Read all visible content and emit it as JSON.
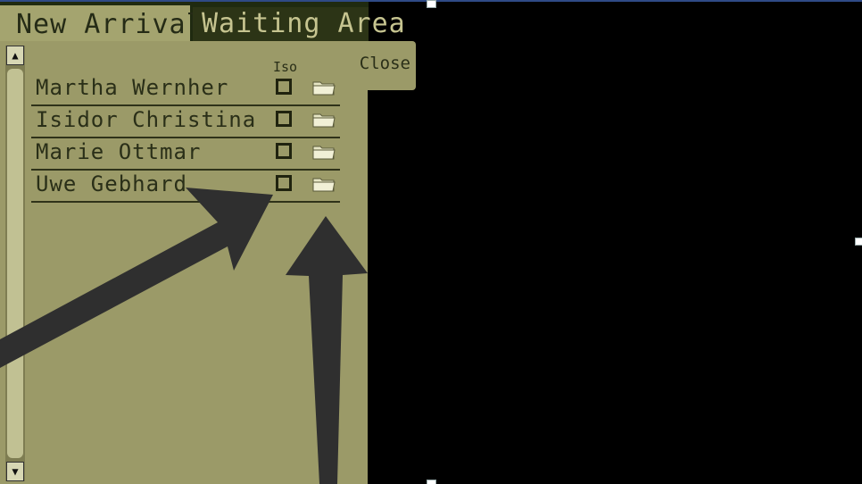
{
  "tabs": [
    {
      "label": "New Arrivals"
    },
    {
      "label": "Waiting Area"
    }
  ],
  "close_label": "Close",
  "columns": {
    "iso": "Iso"
  },
  "patients": [
    {
      "name": "Martha Wernher",
      "iso": false
    },
    {
      "name": "Isidor Christina",
      "iso": false
    },
    {
      "name": "Marie Ottmar",
      "iso": false
    },
    {
      "name": "Uwe Gebhard",
      "iso": false
    }
  ],
  "scrollbar": {
    "up_glyph": "▲",
    "down_glyph": "▼"
  },
  "icons": {
    "folder": "folder-icon",
    "checkbox": "checkbox-icon",
    "arrow": "arrow-annotation"
  },
  "colors": {
    "panel": "#9b9a68",
    "active_tab": "#a4a46f",
    "inactive_tab": "#2c3416",
    "text": "#2a2f18",
    "annotation_arrow": "#2f2f2f"
  }
}
